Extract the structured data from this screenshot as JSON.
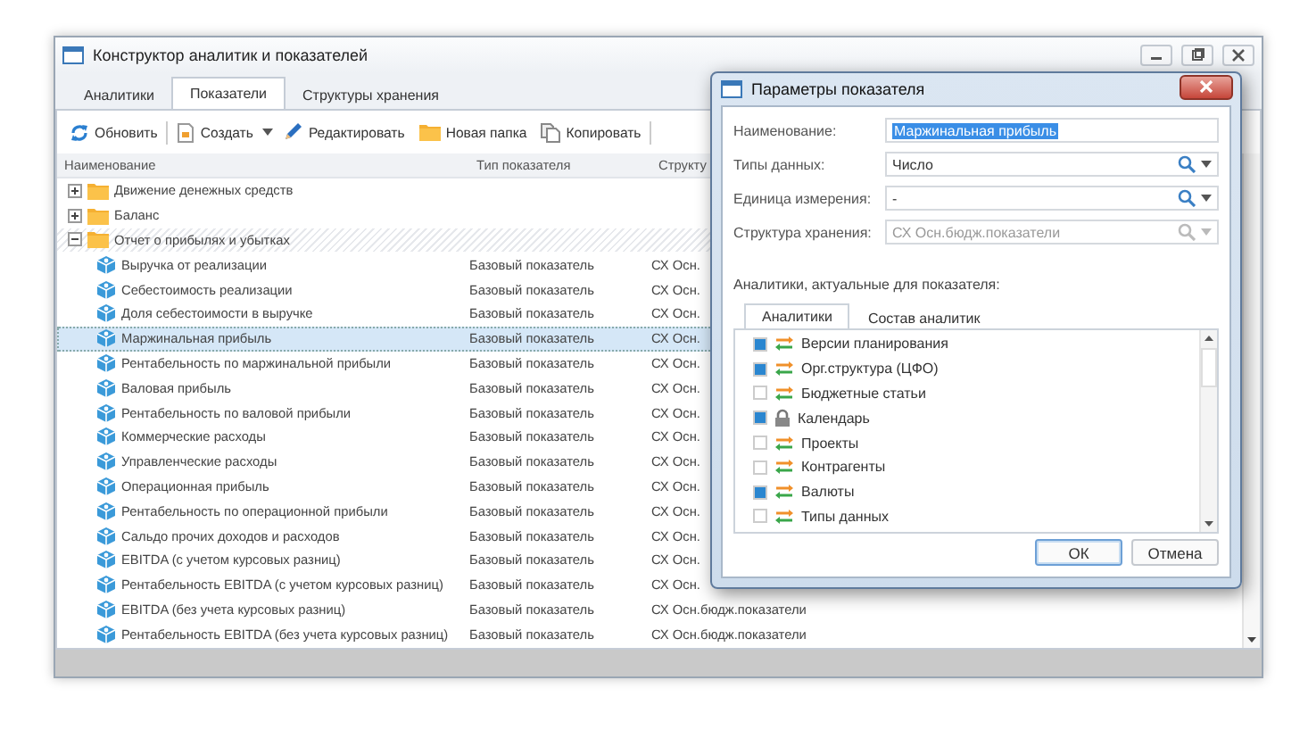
{
  "window": {
    "title": "Конструктор аналитик и показателей"
  },
  "tabs": [
    {
      "label": "Аналитики",
      "selected": false
    },
    {
      "label": "Показатели",
      "selected": true
    },
    {
      "label": "Структуры хранения",
      "selected": false
    }
  ],
  "toolbar": [
    {
      "kind": "refresh",
      "label": "Обновить"
    },
    {
      "kind": "create",
      "label": "Создать"
    },
    {
      "kind": "edit",
      "label": "Редактировать"
    },
    {
      "kind": "folder",
      "label": "Новая папка"
    },
    {
      "kind": "copy",
      "label": "Копировать"
    }
  ],
  "table": {
    "columns": [
      "Наименование",
      "Тип показателя",
      "Структу"
    ],
    "rows": [
      {
        "kind": "folder",
        "name": "Движение денежных средств",
        "expanded": false
      },
      {
        "kind": "folder",
        "name": "Баланс",
        "expanded": false
      },
      {
        "kind": "folder",
        "name": "Отчет о прибылях и убытках",
        "expanded": true,
        "children": [
          {
            "name": "Выручка от реализации",
            "type": "Базовый показатель",
            "storage": "СХ Осн.",
            "selected": false
          },
          {
            "name": "Себестоимость реализации",
            "type": "Базовый показатель",
            "storage": "СХ Осн.",
            "selected": false
          },
          {
            "name": "Доля себестоимости в выручке",
            "type": "Базовый показатель",
            "storage": "СХ Осн.",
            "selected": false
          },
          {
            "name": "Маржинальная прибыль",
            "type": "Базовый показатель",
            "storage": "СХ Осн.",
            "selected": true
          },
          {
            "name": "Рентабельность по маржинальной прибыли",
            "type": "Базовый показатель",
            "storage": "СХ Осн.",
            "selected": false
          },
          {
            "name": "Валовая прибыль",
            "type": "Базовый показатель",
            "storage": "СХ Осн.",
            "selected": false
          },
          {
            "name": "Рентабельность по валовой прибыли",
            "type": "Базовый показатель",
            "storage": "СХ Осн.",
            "selected": false
          },
          {
            "name": "Коммерческие расходы",
            "type": "Базовый показатель",
            "storage": "СХ Осн.",
            "selected": false
          },
          {
            "name": "Управленческие расходы",
            "type": "Базовый показатель",
            "storage": "СХ Осн.",
            "selected": false
          },
          {
            "name": "Операционная прибыль",
            "type": "Базовый показатель",
            "storage": "СХ Осн.",
            "selected": false
          },
          {
            "name": "Рентабельность по операционной прибыли",
            "type": "Базовый показатель",
            "storage": "СХ Осн.",
            "selected": false
          },
          {
            "name": "Сальдо прочих доходов и расходов",
            "type": "Базовый показатель",
            "storage": "СХ Осн.",
            "selected": false
          },
          {
            "name": "EBITDA (с учетом курсовых разниц)",
            "type": "Базовый показатель",
            "storage": "СХ Осн.",
            "selected": false
          },
          {
            "name": "Рентабельность EBITDA (с учетом курсовых разниц)",
            "type": "Базовый показатель",
            "storage": "СХ Осн.",
            "selected": false
          },
          {
            "name": "EBITDA (без учета курсовых разниц)",
            "type": "Базовый показатель",
            "storage": "СХ Осн.бюдж.показатели",
            "selected": false
          },
          {
            "name": "Рентабельность EBITDA (без учета курсовых разниц)",
            "type": "Базовый показатель",
            "storage": "СХ Осн.бюдж.показатели",
            "selected": false
          }
        ]
      }
    ]
  },
  "dialog": {
    "title": "Параметры показателя",
    "fields": [
      {
        "label": "Наименование:",
        "value": "Маржинальная прибыль",
        "kind": "text",
        "highlighted": true,
        "disabled": false
      },
      {
        "label": "Типы данных:",
        "value": "Число",
        "kind": "lookup",
        "highlighted": false,
        "disabled": false
      },
      {
        "label": "Единица измерения:",
        "value": "-",
        "kind": "lookup",
        "highlighted": false,
        "disabled": false
      },
      {
        "label": "Структура хранения:",
        "value": "СХ Осн.бюдж.показатели",
        "kind": "lookup",
        "highlighted": false,
        "disabled": true
      }
    ],
    "section_label": "Аналитики, актуальные для показателя:",
    "tabs": [
      {
        "label": "Аналитики",
        "selected": true
      },
      {
        "label": "Состав аналитик",
        "selected": false
      }
    ],
    "analytics": [
      {
        "kind": "dimension",
        "name": "Версии планирования",
        "checked": true
      },
      {
        "kind": "dimension",
        "name": "Орг.структура (ЦФО)",
        "checked": true
      },
      {
        "kind": "dimension",
        "name": "Бюджетные статьи",
        "checked": false
      },
      {
        "kind": "locked",
        "name": "Календарь",
        "checked": true
      },
      {
        "kind": "dimension",
        "name": "Проекты",
        "checked": false
      },
      {
        "kind": "dimension",
        "name": "Контрагенты",
        "checked": false
      },
      {
        "kind": "dimension",
        "name": "Валюты",
        "checked": true
      },
      {
        "kind": "dimension",
        "name": "Типы данных",
        "checked": false
      }
    ],
    "buttons": [
      {
        "kind": "primary",
        "label": "ОК"
      },
      {
        "kind": "normal",
        "label": "Отмена"
      }
    ]
  }
}
